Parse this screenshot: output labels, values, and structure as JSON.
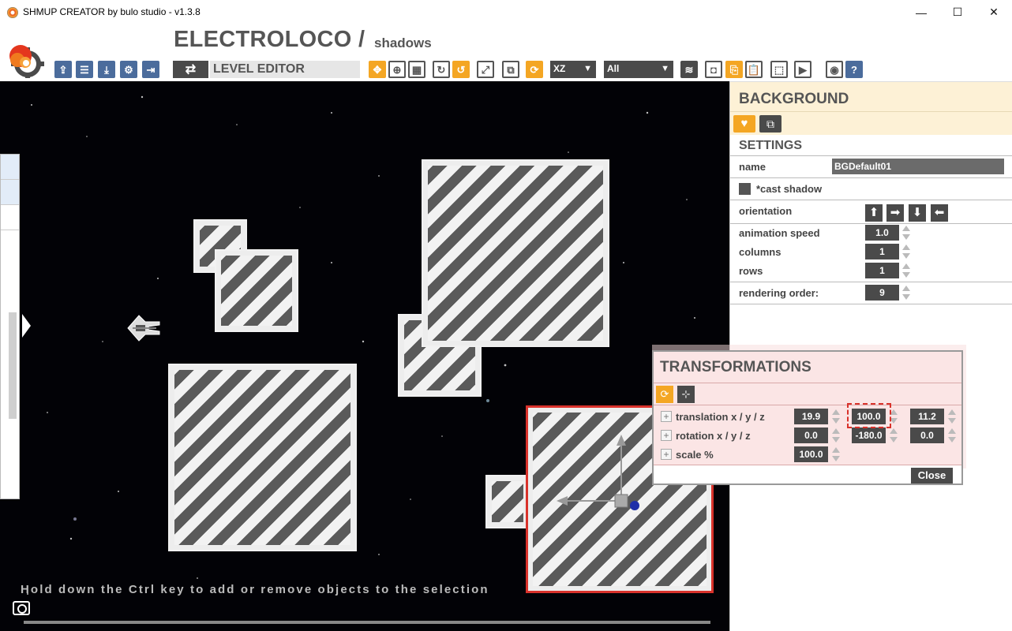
{
  "window": {
    "title": "SHMUP CREATOR by bulo studio - v1.3.8",
    "minimize": "—",
    "maximize": "☐",
    "close": "✕"
  },
  "header": {
    "project_title": "ELECTROLOCO /",
    "scene_title": "shadows",
    "level_editor_label": "LEVEL EDITOR",
    "axis_dropdown": "XZ",
    "filter_dropdown": "All"
  },
  "viewport": {
    "hint": "Hold down the Ctrl key to add or remove objects to the selection"
  },
  "background_panel": {
    "title": "BACKGROUND",
    "settings_title": "SETTINGS",
    "name_label": "name",
    "name_value": "BGDefault01",
    "cast_shadow_label": "*cast shadow",
    "orientation_label": "orientation",
    "animation_speed_label": "animation speed",
    "animation_speed": "1.0",
    "columns_label": "columns",
    "columns": "1",
    "rows_label": "rows",
    "rows": "1",
    "rendering_order_label": "rendering order:",
    "rendering_order": "9"
  },
  "transformations": {
    "title": "TRANSFORMATIONS",
    "translation_label": "translation x / y / z",
    "translation": [
      "19.9",
      "100.0",
      "11.2"
    ],
    "rotation_label": "rotation x / y / z",
    "rotation": [
      "0.0",
      "-180.0",
      "0.0"
    ],
    "scale_label": "scale %",
    "scale": "100.0",
    "close_label": "Close"
  },
  "colors": {
    "accent_orange": "#f4a623",
    "toolbar_blue": "#4b6c9c",
    "selection_red": "#d9322b"
  }
}
